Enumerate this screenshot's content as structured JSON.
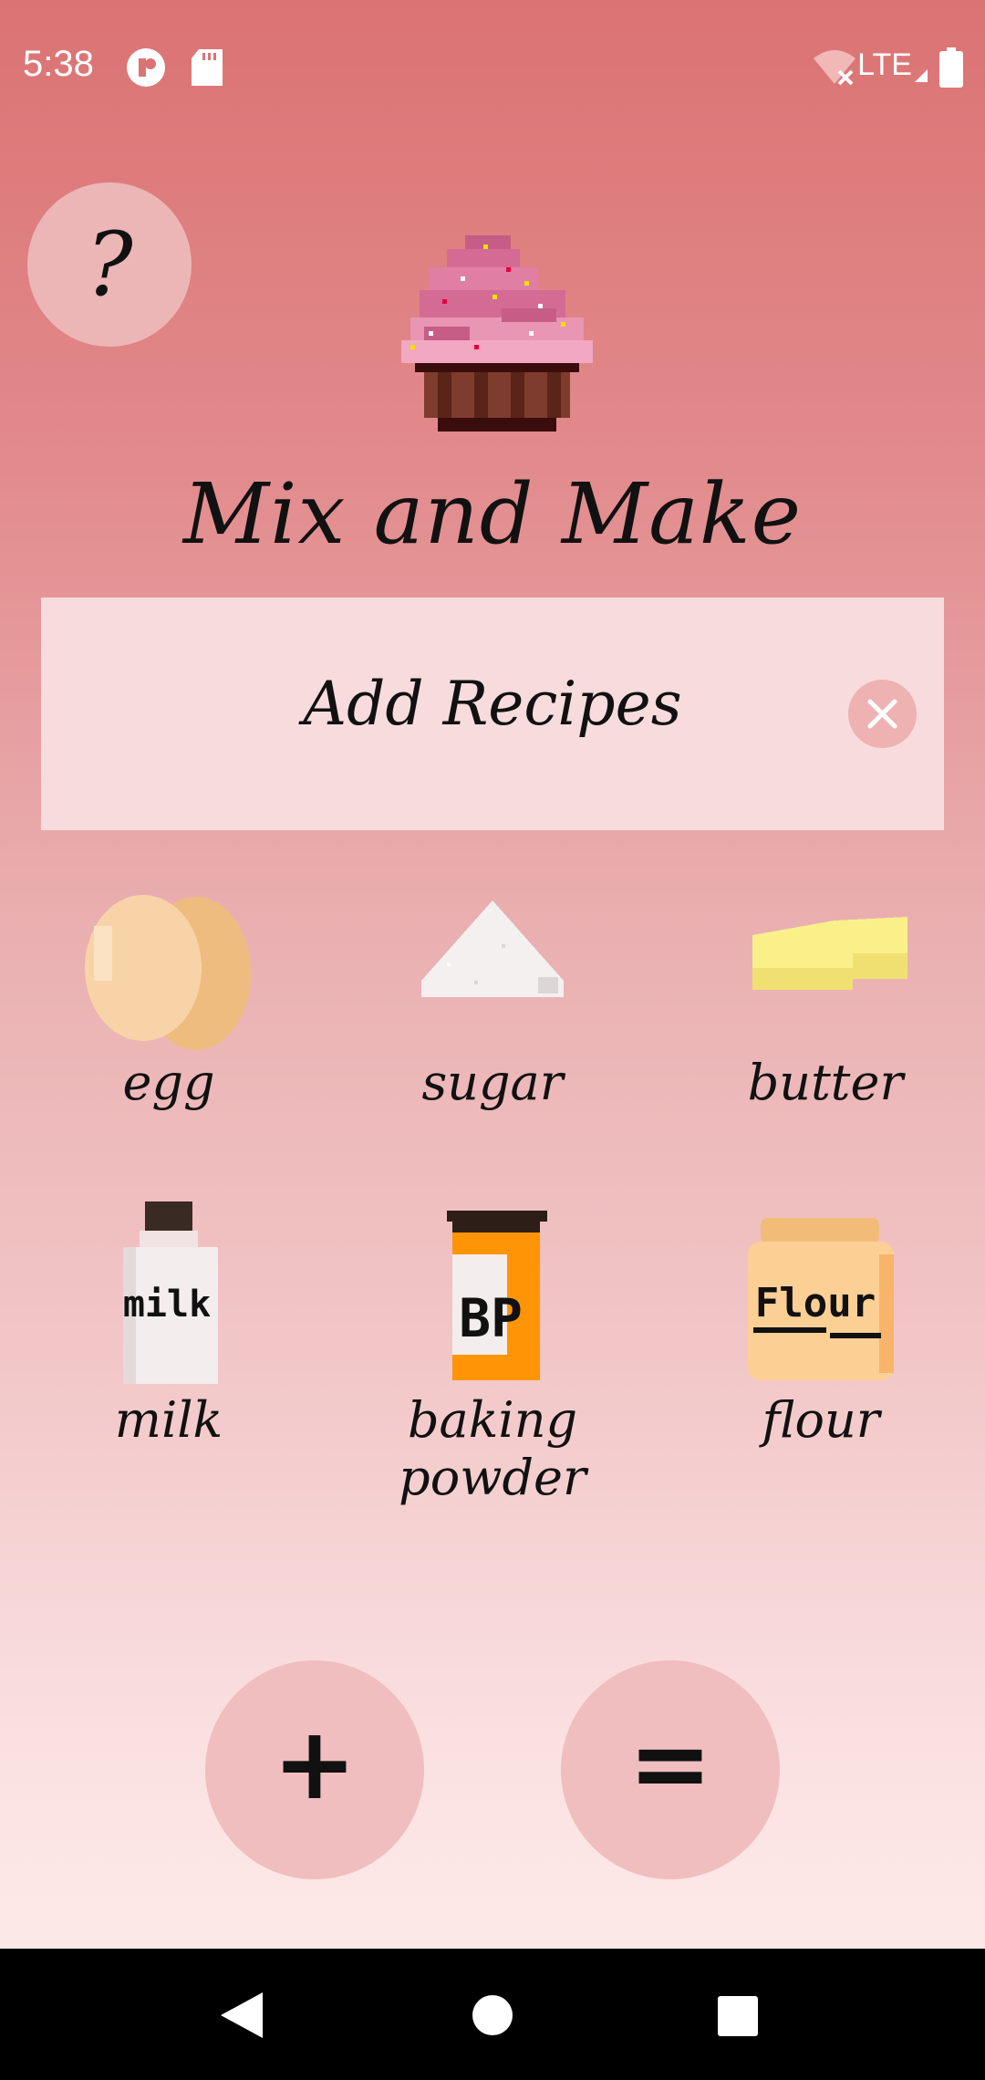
{
  "status_bar": {
    "time": "5:38",
    "network": "LTE",
    "icons": [
      "app-notification-icon",
      "sd-card-icon",
      "wifi-off-icon",
      "signal-icon",
      "battery-icon"
    ]
  },
  "header": {
    "help_label": "?",
    "logo": "cupcake-icon",
    "title": "Mix and Make"
  },
  "recipe_banner": {
    "title": "Add Recipes",
    "close_icon": "close-icon"
  },
  "ingredients": [
    {
      "label": "egg",
      "icon": "egg-icon"
    },
    {
      "label": "sugar",
      "icon": "sugar-icon"
    },
    {
      "label": "butter",
      "icon": "butter-icon"
    },
    {
      "label": "milk",
      "icon": "milk-bottle-icon",
      "icon_text": "milk"
    },
    {
      "label": "baking powder",
      "icon": "baking-powder-icon",
      "icon_text": "BP"
    },
    {
      "label": "flour",
      "icon": "flour-bag-icon",
      "icon_text": "Flour"
    }
  ],
  "actions": {
    "add_label": "+",
    "equals_label": "="
  },
  "colors": {
    "gradient_top": "#db7373",
    "gradient_bottom": "#fde8e8",
    "banner_bg": "#f8dcdd",
    "button_bg": "#f0bebf",
    "help_bg": "#ecb6b6"
  }
}
